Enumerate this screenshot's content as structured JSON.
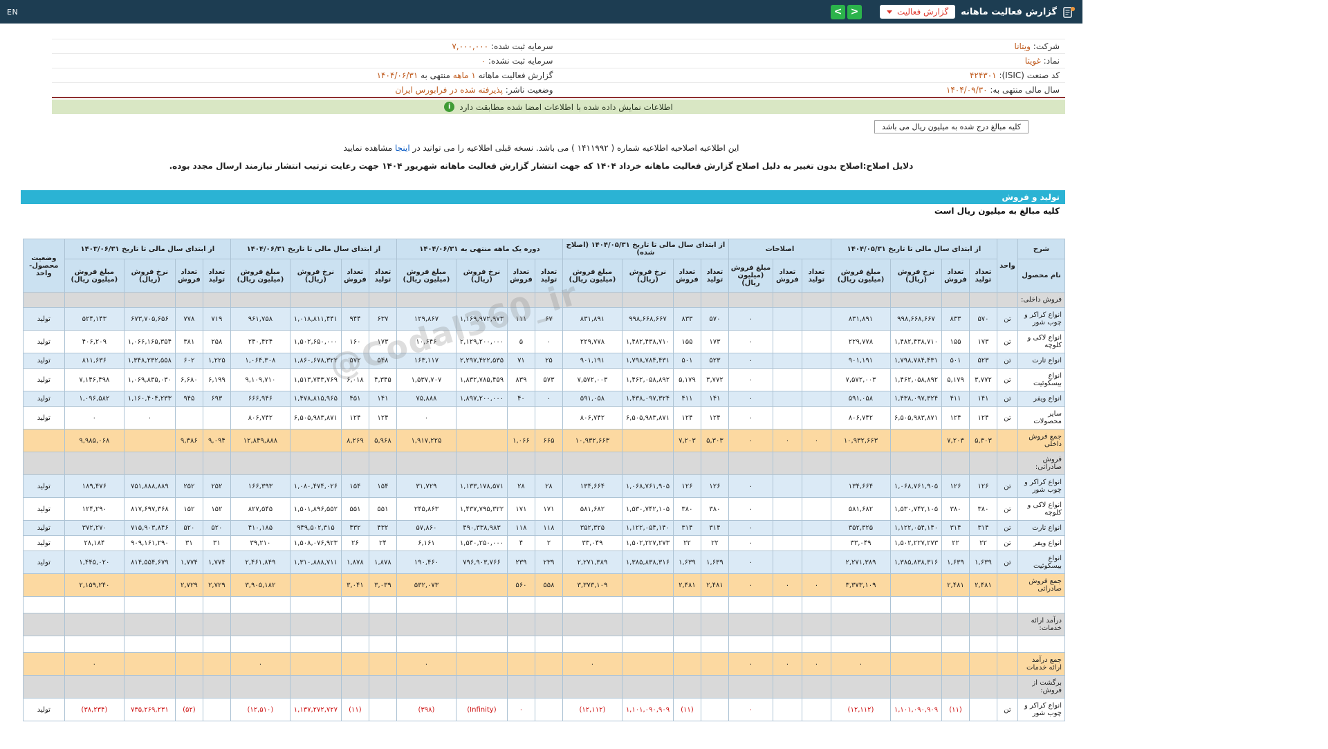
{
  "colors": {
    "navbar_bg": "#1d3d52",
    "green_button": "#2bb34b",
    "red_accent": "#e03a2f",
    "value_orange": "#bf5a1d",
    "green_bar": "#d9e7c4",
    "cyan_bar": "#2bb3d4",
    "table_header_bg": "#cbe1f1",
    "table_border": "#adc3d4",
    "zebra_blue": "#dbeaf6",
    "section_gray": "#d9d9d9",
    "sum_orange": "#fcd9a1",
    "negative_red": "#cc1111"
  },
  "navbar": {
    "title": "گزارش فعالیت ماهانه",
    "report_type_button": "گزارش فعالیت",
    "prev_arrow": "<",
    "next_arrow": ">",
    "en_link": "EN"
  },
  "info": {
    "right": [
      {
        "label": "شرکت:",
        "value": "ویتانا"
      },
      {
        "label": "نماد:",
        "value": "غویتا"
      },
      {
        "label": "کد صنعت (ISIC):",
        "value": "۴۲۴۳۰۱"
      },
      {
        "label": "سال مالی منتهی به:",
        "value": "۱۴۰۴/۰۹/۳۰"
      }
    ],
    "left": [
      {
        "label": "سرمایه ثبت شده:",
        "value": "۷,۰۰۰,۰۰۰"
      },
      {
        "label": "سرمایه ثبت نشده:",
        "value": "۰"
      },
      {
        "label": "گزارش فعالیت ماهانه",
        "value": "۱ ماهه",
        "label2": "منتهی به",
        "value2": "۱۴۰۴/۰۶/۳۱"
      },
      {
        "label": "وضعیت ناشر:",
        "value": "پذیرفته شده در فرابورس ایران"
      }
    ]
  },
  "notices": {
    "signed_match": "اطلاعات نمایش داده شده با اطلاعات امضا شده مطابقت دارد",
    "amounts_box": "کلیه مبالغ درج شده به میلیون ریال می باشد",
    "amendment_pre": "این اطلاعیه اصلاحیه اطلاعیه شماره ( ۱۴۱۱۹۹۲ ) می باشد. نسخه قبلی اطلاعیه را می توانید در",
    "amendment_link": "اینجا",
    "amendment_post": "مشاهده نمایید",
    "reason": "دلایل اصلاح:اصلاح بدون تغییر به دلیل اصلاح گزارش فعالیت ماهانه خرداد ۱۴۰۴ که جهت انتشار گزارش فعالیت ماهانه شهریور ۱۴۰۴ جهت رعایت ترتیب انتشار نیازمند ارسال مجدد بوده."
  },
  "section": {
    "title": "تولید و فروش",
    "subtitle": "کلیه مبالغ به میلیون ریال است"
  },
  "watermark": "@Codal360_ir",
  "table": {
    "header": {
      "desc": "شرح",
      "product": "نام محصول",
      "unit": "واحد",
      "status": "وضعیت محصول-واحد",
      "groups": [
        {
          "key": "g1404_05",
          "title": "از ابتدای سال مالی تا تاریخ ۱۴۰۴/۰۵/۳۱",
          "cols": [
            "تعداد تولید",
            "تعداد فروش",
            "نرخ فروش (ریال)",
            "مبلغ فروش (میلیون ریال)"
          ]
        },
        {
          "key": "corrections",
          "title": "اصلاحات",
          "cols": [
            "تعداد تولید",
            "تعداد فروش",
            "مبلغ فروش (میلیون ریال)"
          ]
        },
        {
          "key": "amended",
          "title": "از ابتدای سال مالی تا تاریخ ۱۴۰۴/۰۵/۳۱ (اصلاح شده)",
          "cols": [
            "تعداد تولید",
            "تعداد فروش",
            "نرخ فروش (ریال)",
            "مبلغ فروش (میلیون ریال)"
          ]
        },
        {
          "key": "month",
          "title": "دوره یک ماهه منتهی به ۱۴۰۴/۰۶/۳۱",
          "cols": [
            "تعداد تولید",
            "تعداد فروش",
            "نرخ فروش (ریال)",
            "مبلغ فروش (میلیون ریال)"
          ]
        },
        {
          "key": "g1404_06",
          "title": "از ابتدای سال مالی تا تاریخ ۱۴۰۴/۰۶/۳۱",
          "cols": [
            "تعداد تولید",
            "تعداد فروش",
            "نرخ فروش (ریال)",
            "مبلغ فروش (میلیون ریال)"
          ]
        },
        {
          "key": "g1403_06",
          "title": "از ابتدای سال مالی تا تاریخ ۱۴۰۳/۰۶/۳۱",
          "cols": [
            "تعداد تولید",
            "تعداد فروش",
            "نرخ فروش (ریال)",
            "مبلغ فروش (میلیون ریال)"
          ]
        }
      ]
    },
    "rows": [
      {
        "type": "section",
        "name": "فروش داخلی:"
      },
      {
        "type": "data",
        "shade": true,
        "name": "انواع کراکر و چوب شور",
        "unit": "تن",
        "status": "تولید",
        "g1404_05": [
          "۵۷۰",
          "۸۳۳",
          "۹۹۸,۶۶۸,۶۶۷",
          "۸۳۱,۸۹۱"
        ],
        "corrections": [
          "",
          "",
          "۰"
        ],
        "amended": [
          "۵۷۰",
          "۸۳۳",
          "۹۹۸,۶۶۸,۶۶۷",
          "۸۳۱,۸۹۱"
        ],
        "month": [
          "۶۷",
          "۱۱۱",
          "۱,۱۶۹,۹۷۲,۹۷۳",
          "۱۲۹,۸۶۷"
        ],
        "g1404_06": [
          "۶۳۷",
          "۹۴۴",
          "۱,۰۱۸,۸۱۱,۴۴۱",
          "۹۶۱,۷۵۸"
        ],
        "g1403_06": [
          "۷۱۹",
          "۷۷۸",
          "۶۷۳,۷۰۵,۶۵۶",
          "۵۲۴,۱۴۳"
        ]
      },
      {
        "type": "data",
        "shade": false,
        "name": "انواع لاکی و کلوچه",
        "unit": "تن",
        "status": "تولید",
        "g1404_05": [
          "۱۷۳",
          "۱۵۵",
          "۱,۴۸۲,۴۳۸,۷۱۰",
          "۲۲۹,۷۷۸"
        ],
        "corrections": [
          "",
          "",
          "۰"
        ],
        "amended": [
          "۱۷۳",
          "۱۵۵",
          "۱,۴۸۲,۴۳۸,۷۱۰",
          "۲۲۹,۷۷۸"
        ],
        "month": [
          "۰",
          "۵",
          "۲,۱۲۹,۲۰۰,۰۰۰",
          "۱۰,۶۴۶"
        ],
        "g1404_06": [
          "۱۷۳",
          "۱۶۰",
          "۱,۵۰۲,۶۵۰,۰۰۰",
          "۲۴۰,۴۲۴"
        ],
        "g1403_06": [
          "۲۵۸",
          "۳۸۱",
          "۱,۰۶۶,۱۶۵,۳۵۴",
          "۴۰۶,۲۰۹"
        ]
      },
      {
        "type": "data",
        "shade": true,
        "name": "انواع تارت",
        "unit": "تن",
        "status": "تولید",
        "g1404_05": [
          "۵۲۳",
          "۵۰۱",
          "۱,۷۹۸,۷۸۴,۴۳۱",
          "۹۰۱,۱۹۱"
        ],
        "corrections": [
          "",
          "",
          "۰"
        ],
        "amended": [
          "۵۲۳",
          "۵۰۱",
          "۱,۷۹۸,۷۸۴,۴۳۱",
          "۹۰۱,۱۹۱"
        ],
        "month": [
          "۲۵",
          "۷۱",
          "۲,۲۹۷,۴۲۲,۵۳۵",
          "۱۶۳,۱۱۷"
        ],
        "g1404_06": [
          "۵۴۸",
          "۵۷۲",
          "۱,۸۶۰,۶۷۸,۳۲۲",
          "۱,۰۶۴,۳۰۸"
        ],
        "g1403_06": [
          "۱,۲۲۵",
          "۶۰۲",
          "۱,۳۴۸,۲۳۲,۵۵۸",
          "۸۱۱,۶۳۶"
        ]
      },
      {
        "type": "data",
        "shade": false,
        "name": "انواع بیسکوئیت",
        "unit": "تن",
        "status": "تولید",
        "g1404_05": [
          "۳,۷۷۲",
          "۵,۱۷۹",
          "۱,۴۶۲,۰۵۸,۸۹۲",
          "۷,۵۷۲,۰۰۳"
        ],
        "corrections": [
          "",
          "",
          "۰"
        ],
        "amended": [
          "۳,۷۷۲",
          "۵,۱۷۹",
          "۱,۴۶۲,۰۵۸,۸۹۲",
          "۷,۵۷۲,۰۰۳"
        ],
        "month": [
          "۵۷۳",
          "۸۳۹",
          "۱,۸۳۲,۷۸۵,۴۵۹",
          "۱,۵۳۷,۷۰۷"
        ],
        "g1404_06": [
          "۴,۳۴۵",
          "۶,۰۱۸",
          "۱,۵۱۳,۷۴۳,۷۶۹",
          "۹,۱۰۹,۷۱۰"
        ],
        "g1403_06": [
          "۶,۱۹۹",
          "۶,۶۸۰",
          "۱,۰۶۹,۸۳۵,۰۳۰",
          "۷,۱۴۶,۴۹۸"
        ]
      },
      {
        "type": "data",
        "shade": true,
        "name": "انواع ویفر",
        "unit": "تن",
        "status": "تولید",
        "g1404_05": [
          "۱۴۱",
          "۴۱۱",
          "۱,۴۳۸,۰۹۷,۳۲۴",
          "۵۹۱,۰۵۸"
        ],
        "corrections": [
          "",
          "",
          "۰"
        ],
        "amended": [
          "۱۴۱",
          "۴۱۱",
          "۱,۴۳۸,۰۹۷,۳۲۴",
          "۵۹۱,۰۵۸"
        ],
        "month": [
          "۰",
          "۴۰",
          "۱,۸۹۷,۲۰۰,۰۰۰",
          "۷۵,۸۸۸"
        ],
        "g1404_06": [
          "۱۴۱",
          "۴۵۱",
          "۱,۴۷۸,۸۱۵,۹۶۵",
          "۶۶۶,۹۴۶"
        ],
        "g1403_06": [
          "۶۹۳",
          "۹۴۵",
          "۱,۱۶۰,۴۰۴,۲۳۳",
          "۱,۰۹۶,۵۸۲"
        ]
      },
      {
        "type": "data",
        "shade": false,
        "name": "سایر محصولات",
        "unit": "تن",
        "status": "تولید",
        "g1404_05": [
          "۱۲۴",
          "۱۲۴",
          "۶,۵۰۵,۹۸۳,۸۷۱",
          "۸۰۶,۷۴۲"
        ],
        "corrections": [
          "",
          "",
          "۰"
        ],
        "amended": [
          "۱۲۴",
          "۱۲۴",
          "۶,۵۰۵,۹۸۳,۸۷۱",
          "۸۰۶,۷۴۲"
        ],
        "month": [
          "",
          "",
          "",
          "۰"
        ],
        "g1404_06": [
          "۱۲۴",
          "۱۲۴",
          "۶,۵۰۵,۹۸۳,۸۷۱",
          "۸۰۶,۷۴۲"
        ],
        "g1403_06": [
          "",
          "",
          "۰",
          "۰"
        ]
      },
      {
        "type": "sum",
        "name": "جمع فروش داخلی",
        "unit": "",
        "status": "",
        "g1404_05": [
          "۵,۳۰۳",
          "۷,۲۰۳",
          "",
          "۱۰,۹۳۲,۶۶۳"
        ],
        "corrections": [
          "۰",
          "۰",
          "۰"
        ],
        "amended": [
          "۵,۳۰۳",
          "۷,۲۰۳",
          "",
          "۱۰,۹۳۲,۶۶۳"
        ],
        "month": [
          "۶۶۵",
          "۱,۰۶۶",
          "",
          "۱,۹۱۷,۲۲۵"
        ],
        "g1404_06": [
          "۵,۹۶۸",
          "۸,۲۶۹",
          "",
          "۱۲,۸۴۹,۸۸۸"
        ],
        "g1403_06": [
          "۹,۰۹۴",
          "۹,۳۸۶",
          "",
          "۹,۹۸۵,۰۶۸"
        ]
      },
      {
        "type": "section",
        "name": "فروش صادراتی:"
      },
      {
        "type": "data",
        "shade": true,
        "name": "انواع کراکر و چوب شور",
        "unit": "تن",
        "status": "تولید",
        "g1404_05": [
          "۱۲۶",
          "۱۲۶",
          "۱,۰۶۸,۷۶۱,۹۰۵",
          "۱۳۴,۶۶۴"
        ],
        "corrections": [
          "",
          "",
          "۰"
        ],
        "amended": [
          "۱۲۶",
          "۱۲۶",
          "۱,۰۶۸,۷۶۱,۹۰۵",
          "۱۳۴,۶۶۴"
        ],
        "month": [
          "۲۸",
          "۲۸",
          "۱,۱۳۳,۱۷۸,۵۷۱",
          "۳۱,۷۲۹"
        ],
        "g1404_06": [
          "۱۵۴",
          "۱۵۴",
          "۱,۰۸۰,۴۷۴,۰۲۶",
          "۱۶۶,۳۹۳"
        ],
        "g1403_06": [
          "۲۵۲",
          "۲۵۲",
          "۷۵۱,۸۸۸,۸۸۹",
          "۱۸۹,۴۷۶"
        ]
      },
      {
        "type": "data",
        "shade": false,
        "name": "انواع لاکی و کلوچه",
        "unit": "تن",
        "status": "تولید",
        "g1404_05": [
          "۳۸۰",
          "۳۸۰",
          "۱,۵۳۰,۷۴۲,۱۰۵",
          "۵۸۱,۶۸۲"
        ],
        "corrections": [
          "",
          "",
          "۰"
        ],
        "amended": [
          "۳۸۰",
          "۳۸۰",
          "۱,۵۳۰,۷۴۲,۱۰۵",
          "۵۸۱,۶۸۲"
        ],
        "month": [
          "۱۷۱",
          "۱۷۱",
          "۱,۴۳۷,۷۹۵,۳۲۲",
          "۲۴۵,۸۶۳"
        ],
        "g1404_06": [
          "۵۵۱",
          "۵۵۱",
          "۱,۵۰۱,۸۹۶,۵۵۲",
          "۸۲۷,۵۴۵"
        ],
        "g1403_06": [
          "۱۵۲",
          "۱۵۲",
          "۸۱۷,۶۹۷,۳۶۸",
          "۱۲۴,۲۹۰"
        ]
      },
      {
        "type": "data",
        "shade": true,
        "name": "انواع تارت",
        "unit": "تن",
        "status": "تولید",
        "g1404_05": [
          "۳۱۴",
          "۳۱۴",
          "۱,۱۲۲,۰۵۴,۱۴۰",
          "۳۵۲,۳۲۵"
        ],
        "corrections": [
          "",
          "",
          "۰"
        ],
        "amended": [
          "۳۱۴",
          "۳۱۴",
          "۱,۱۲۲,۰۵۴,۱۴۰",
          "۳۵۲,۳۲۵"
        ],
        "month": [
          "۱۱۸",
          "۱۱۸",
          "۴۹۰,۳۳۸,۹۸۳",
          "۵۷,۸۶۰"
        ],
        "g1404_06": [
          "۴۳۲",
          "۴۳۲",
          "۹۴۹,۵۰۲,۳۱۵",
          "۴۱۰,۱۸۵"
        ],
        "g1403_06": [
          "۵۲۰",
          "۵۲۰",
          "۷۱۵,۹۰۳,۸۴۶",
          "۳۷۲,۲۷۰"
        ]
      },
      {
        "type": "data",
        "shade": false,
        "name": "انواع ویفر",
        "unit": "تن",
        "status": "تولید",
        "g1404_05": [
          "۲۲",
          "۲۲",
          "۱,۵۰۲,۲۲۷,۲۷۳",
          "۳۳,۰۴۹"
        ],
        "corrections": [
          "",
          "",
          "۰"
        ],
        "amended": [
          "۲۲",
          "۲۲",
          "۱,۵۰۲,۲۲۷,۲۷۳",
          "۳۳,۰۴۹"
        ],
        "month": [
          "۲",
          "۴",
          "۱,۵۴۰,۲۵۰,۰۰۰",
          "۶,۱۶۱"
        ],
        "g1404_06": [
          "۲۴",
          "۲۶",
          "۱,۵۰۸,۰۷۶,۹۲۳",
          "۳۹,۲۱۰"
        ],
        "g1403_06": [
          "۳۱",
          "۳۱",
          "۹۰۹,۱۶۱,۲۹۰",
          "۲۸,۱۸۴"
        ]
      },
      {
        "type": "data",
        "shade": true,
        "name": "انواع بیسکوئیت",
        "unit": "تن",
        "status": "تولید",
        "g1404_05": [
          "۱,۶۳۹",
          "۱,۶۳۹",
          "۱,۳۸۵,۸۳۸,۳۱۶",
          "۲,۲۷۱,۳۸۹"
        ],
        "corrections": [
          "",
          "",
          "۰"
        ],
        "amended": [
          "۱,۶۳۹",
          "۱,۶۳۹",
          "۱,۳۸۵,۸۳۸,۳۱۶",
          "۲,۲۷۱,۳۸۹"
        ],
        "month": [
          "۲۳۹",
          "۲۳۹",
          "۷۹۶,۹۰۳,۷۶۶",
          "۱۹۰,۴۶۰"
        ],
        "g1404_06": [
          "۱,۸۷۸",
          "۱,۸۷۸",
          "۱,۳۱۰,۸۸۸,۷۱۱",
          "۲,۴۶۱,۸۴۹"
        ],
        "g1403_06": [
          "۱,۷۷۴",
          "۱,۷۷۴",
          "۸۱۴,۵۵۴,۶۷۹",
          "۱,۴۴۵,۰۲۰"
        ]
      },
      {
        "type": "sum",
        "name": "جمع فروش صادراتی",
        "unit": "",
        "status": "",
        "g1404_05": [
          "۲,۴۸۱",
          "۲,۴۸۱",
          "",
          "۳,۳۷۳,۱۰۹"
        ],
        "corrections": [
          "۰",
          "۰",
          "۰"
        ],
        "amended": [
          "۲,۴۸۱",
          "۲,۴۸۱",
          "",
          "۳,۳۷۳,۱۰۹"
        ],
        "month": [
          "۵۵۸",
          "۵۶۰",
          "",
          "۵۳۲,۰۷۳"
        ],
        "g1404_06": [
          "۳,۰۳۹",
          "۳,۰۴۱",
          "",
          "۳,۹۰۵,۱۸۲"
        ],
        "g1403_06": [
          "۲,۷۲۹",
          "۲,۷۲۹",
          "",
          "۲,۱۵۹,۲۴۰"
        ]
      },
      {
        "type": "empty"
      },
      {
        "type": "section",
        "name": "درآمد ارائه خدمات:"
      },
      {
        "type": "empty"
      },
      {
        "type": "sum",
        "name": "جمع درآمد ارائه خدمات",
        "unit": "",
        "status": "",
        "g1404_05": [
          "",
          "",
          "",
          "۰"
        ],
        "corrections": [
          "۰",
          "۰",
          "۰"
        ],
        "amended": [
          "",
          "",
          "",
          "۰"
        ],
        "month": [
          "",
          "",
          "",
          "۰"
        ],
        "g1404_06": [
          "",
          "",
          "",
          "۰"
        ],
        "g1403_06": [
          "",
          "",
          "",
          "۰"
        ]
      },
      {
        "type": "section",
        "name": "برگشت از فروش:"
      },
      {
        "type": "negative",
        "name": "انواع کراکر و چوب شور",
        "unit": "تن",
        "status": "تولید",
        "g1404_05": [
          "",
          "(۱۱)",
          "۱,۱۰۱,۰۹۰,۹۰۹",
          "(۱۲,۱۱۲)"
        ],
        "corrections": [
          "",
          "",
          "۰"
        ],
        "amended": [
          "",
          "(۱۱)",
          "۱,۱۰۱,۰۹۰,۹۰۹",
          "(۱۲,۱۱۲)"
        ],
        "month": [
          "",
          "۰",
          "(Infinity)",
          "(۳۹۸)"
        ],
        "g1404_06": [
          "",
          "(۱۱)",
          "۱,۱۳۷,۲۷۲,۷۲۷",
          "(۱۲,۵۱۰)"
        ],
        "g1403_06": [
          "",
          "(۵۲)",
          "۷۳۵,۲۶۹,۲۳۱",
          "(۳۸,۲۳۴)"
        ]
      }
    ]
  }
}
